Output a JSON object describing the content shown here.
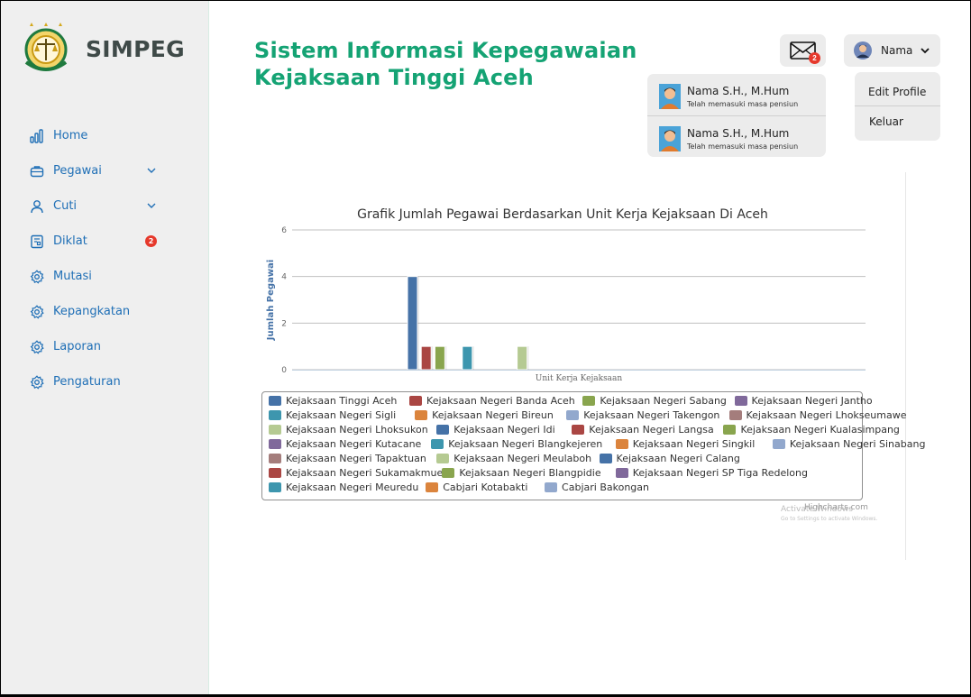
{
  "app": {
    "name": "SIMPEG"
  },
  "header": {
    "title_line1": "Sistem Informasi Kepegawaian",
    "title_line2": "Kejaksaan Tinggi Aceh",
    "mail_badge": "2",
    "user_name": "Nama"
  },
  "sidebar": {
    "items": [
      {
        "label": "Home",
        "icon": "bar-chart-icon"
      },
      {
        "label": "Pegawai",
        "icon": "briefcase-icon"
      },
      {
        "label": "Cuti",
        "icon": "user-icon"
      },
      {
        "label": "Diklat",
        "icon": "document-icon",
        "badge": "2"
      },
      {
        "label": "Mutasi",
        "icon": "gear-icon"
      },
      {
        "label": "Kepangkatan",
        "icon": "gear-icon"
      },
      {
        "label": "Laporan",
        "icon": "gear-icon"
      },
      {
        "label": "Pengaturan",
        "icon": "gear-icon"
      }
    ]
  },
  "notifications": [
    {
      "name": "Nama S.H., M.Hum",
      "message": "Telah memasuki masa pensiun"
    },
    {
      "name": "Nama S.H., M.Hum",
      "message": "Telah memasuki masa pensiun"
    }
  ],
  "profile_menu": {
    "edit": "Edit Profile",
    "logout": "Keluar"
  },
  "watermark": {
    "line1": "Activate Windows",
    "line2": "Go to Settings to activate Windows."
  },
  "credits": "Highcharts.com",
  "colors": {
    "brand_green": "#15a374",
    "nav_blue": "#1f6fb6",
    "badge_red": "#e6392c"
  },
  "chart_data": {
    "type": "bar",
    "title": "Grafik Jumlah Pegawai Berdasarkan Unit Kerja Kejaksaan Di Aceh",
    "xlabel": "Unit Kerja Kejaksaan",
    "ylabel": "Jumlah Pegawai",
    "ylim": [
      0,
      6
    ],
    "yticks": [
      0,
      2,
      4,
      6
    ],
    "grid": true,
    "legend_placement": "bottom",
    "series": [
      {
        "name": "Kejaksaan Tinggi Aceh",
        "value": 4,
        "color": "#4572a7"
      },
      {
        "name": "Kejaksaan Negeri Banda Aceh",
        "value": 1,
        "color": "#aa4643"
      },
      {
        "name": "Kejaksaan Negeri Sabang",
        "value": 1,
        "color": "#89a54e"
      },
      {
        "name": "Kejaksaan Negeri Jantho",
        "value": 0,
        "color": "#80699b"
      },
      {
        "name": "Kejaksaan Negeri Sigli",
        "value": 1,
        "color": "#3d96ae"
      },
      {
        "name": "Kejaksaan Negeri Bireun",
        "value": 0,
        "color": "#db843d"
      },
      {
        "name": "Kejaksaan Negeri Takengon",
        "value": 0,
        "color": "#92a8cd"
      },
      {
        "name": "Kejaksaan Negeri Lhokseumawe",
        "value": 0,
        "color": "#a47d7c"
      },
      {
        "name": "Kejaksaan Negeri Lhoksukon",
        "value": 1,
        "color": "#b5ca92"
      },
      {
        "name": "Kejaksaan Negeri Idi",
        "value": 0,
        "color": "#4572a7"
      },
      {
        "name": "Kejaksaan Negeri Langsa",
        "value": 0,
        "color": "#aa4643"
      },
      {
        "name": "Kejaksaan Negeri Kualasimpang",
        "value": 0,
        "color": "#89a54e"
      },
      {
        "name": "Kejaksaan Negeri Kutacane",
        "value": 0,
        "color": "#80699b"
      },
      {
        "name": "Kejaksaan Negeri Blangkejeren",
        "value": 0,
        "color": "#3d96ae"
      },
      {
        "name": "Kejaksaan Negeri Singkil",
        "value": 0,
        "color": "#db843d"
      },
      {
        "name": "Kejaksaan Negeri Sinabang",
        "value": 0,
        "color": "#92a8cd"
      },
      {
        "name": "Kejaksaan Negeri Tapaktuan",
        "value": 0,
        "color": "#a47d7c"
      },
      {
        "name": "Kejaksaan Negeri Meulaboh",
        "value": 0,
        "color": "#b5ca92"
      },
      {
        "name": "Kejaksaan Negeri Calang",
        "value": 0,
        "color": "#4572a7"
      },
      {
        "name": "Kejaksaan Negeri Sukamakmue",
        "value": 0,
        "color": "#aa4643"
      },
      {
        "name": "Kejaksaan Negeri Blangpidie",
        "value": 0,
        "color": "#89a54e"
      },
      {
        "name": "Kejaksaan Negeri SP Tiga Redelong",
        "value": 0,
        "color": "#80699b"
      },
      {
        "name": "Kejaksaan Negeri Meuredu",
        "value": 0,
        "color": "#3d96ae"
      },
      {
        "name": "Cabjari Kotabakti",
        "value": 0,
        "color": "#db843d"
      },
      {
        "name": "Cabjari Bakongan",
        "value": 0,
        "color": "#92a8cd"
      }
    ]
  }
}
